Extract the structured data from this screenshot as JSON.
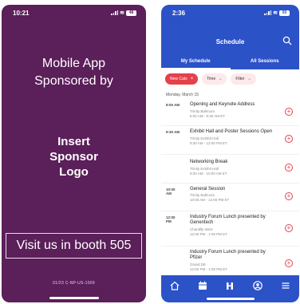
{
  "left": {
    "status": {
      "time": "10:21",
      "battery": "48"
    },
    "headline": "Mobile App Sponsored by",
    "logo_text": "Insert Sponsor Logo",
    "booth_button": "Visit us in booth 505",
    "code": "01/23 C-NP-US-1009"
  },
  "right": {
    "status": {
      "time": "2:36",
      "battery": "50"
    },
    "title": "Schedule",
    "tabs": [
      "My Schedule",
      "All Sessions"
    ],
    "filters": [
      {
        "label": "New Cats",
        "active": true
      },
      {
        "label": "Time",
        "active": false
      },
      {
        "label": "Filter",
        "active": false
      }
    ],
    "day_label": "Monday, March 15",
    "sessions": [
      {
        "time": "8:00 AM",
        "title": "Opening and Keynote Address",
        "title_extra": "",
        "speaker": "Trinity Ballroom",
        "time_range": "8:00 AM - 9:30 AM ET"
      },
      {
        "time": "9:30 AM",
        "title": "Exhibit Hall and Poster Sessions ",
        "title_extra": "Open",
        "speaker": "Trinity Exhibit Hall",
        "time_range": "9:30 AM - 12:00 PM ET"
      },
      {
        "time": "",
        "title": "Networking Break",
        "title_extra": "",
        "speaker": "Trinity Exhibit Hall",
        "time_range": "9:30 AM - 10:00 AM ET"
      },
      {
        "time": "10:00 AM",
        "title": "General Session",
        "title_extra": "",
        "speaker": "Trinity Ballroom",
        "time_range": "10:00 AM - 12:00 PM ET"
      },
      {
        "time": "12:00 PM",
        "title": "Industry Forum Lunch presented by Genentech",
        "title_extra": "",
        "speaker": "Chantilly West",
        "time_range": "12:00 PM - 1:00 PM ET"
      },
      {
        "time": "",
        "title": "Industry Forum Lunch presented by Pfizer",
        "title_extra": "",
        "speaker": "Grand DE",
        "time_range": "12:00 PM - 1:00 PM ET"
      }
    ],
    "nav_icons": [
      "home-icon",
      "calendar-icon",
      "exhibitors-icon",
      "profile-icon",
      "menu-icon"
    ]
  }
}
